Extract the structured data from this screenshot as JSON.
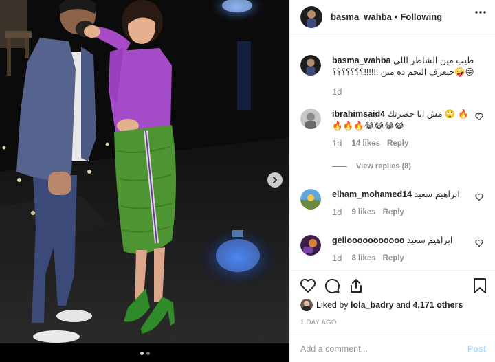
{
  "header": {
    "username": "basma_wahba",
    "separator": "•",
    "follow_status": "Following"
  },
  "caption": {
    "username": "basma_wahba",
    "text": "طيب مين الشاطر اللي 😛🤪حيعرف النجم ده مين !!!!!!؟؟؟؟؟؟؟",
    "age": "1d"
  },
  "comments": [
    {
      "username": "ibrahimsaid4",
      "text": "مش انا حضرتك 🙄 🔥🔥🔥🔥😂😂😂😂",
      "age": "1d",
      "likes": "14 likes",
      "reply_label": "Reply"
    },
    {
      "username": "elham_mohamed14",
      "text": "ابراهيم سعيد",
      "age": "1d",
      "likes": "9 likes",
      "reply_label": "Reply"
    },
    {
      "username": "gellooooooooooo",
      "text": "ابراهيم سعيد",
      "age": "1d",
      "likes": "8 likes",
      "reply_label": "Reply"
    }
  ],
  "view_replies": "View replies (8)",
  "likes_summary": {
    "prefix": "Liked by",
    "user": "lola_badry",
    "joiner": "and",
    "others": "4,171 others"
  },
  "post_date": "1 DAY AGO",
  "add_comment": {
    "placeholder": "Add a comment...",
    "post_label": "Post"
  },
  "carousel": {
    "total": 2,
    "active_index": 0
  },
  "colors": {
    "link_blue": "#b3dbff",
    "muted": "#8e8e8e",
    "text": "#262626"
  },
  "icons": [
    "more-options-icon",
    "like-icon",
    "comment-icon",
    "share-icon",
    "save-icon",
    "chevron-right-icon"
  ]
}
